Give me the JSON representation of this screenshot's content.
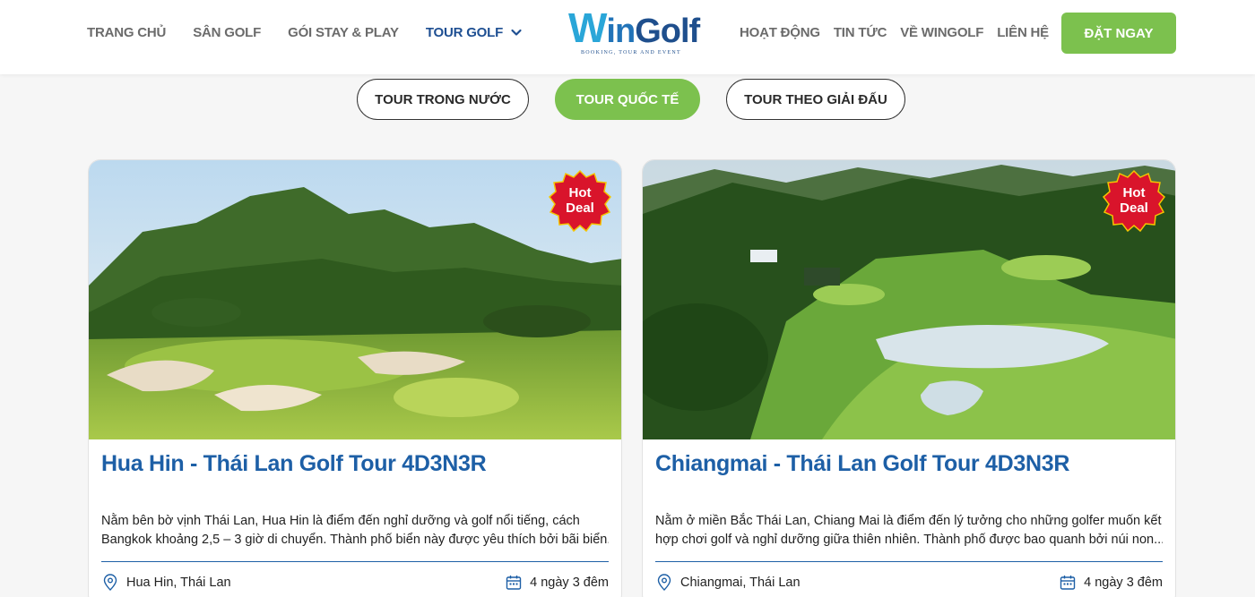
{
  "brand": {
    "logo_w": "W",
    "logo_in": "in",
    "logo_golf": "Golf",
    "tagline": "BOOKING, TOUR AND EVENT",
    "accent": "#7cc14e",
    "primary": "#1d5fa6"
  },
  "nav": {
    "left": [
      "TRANG CHỦ",
      "SÂN GOLF",
      "GÓI STAY & PLAY"
    ],
    "active": "TOUR GOLF",
    "right": [
      "HOẠT ĐỘNG",
      "TIN TỨC",
      "VỀ WINGOLF",
      "LIÊN HỆ"
    ],
    "cta": "ĐẶT NGAY"
  },
  "tabs": [
    {
      "label": "TOUR TRONG NƯỚC",
      "active": false
    },
    {
      "label": "TOUR QUỐC TẾ",
      "active": true
    },
    {
      "label": "TOUR THEO GIẢI ĐẤU",
      "active": false
    }
  ],
  "cards": [
    {
      "badge": [
        "Hot",
        "Deal"
      ],
      "title": "Hua Hin - Thái Lan Golf Tour 4D3N3R",
      "desc": [
        "Nằm bên bờ vịnh Thái Lan, Hua Hin là điểm đến nghỉ dưỡng và golf nổi tiếng, cách",
        "Bangkok khoảng 2,5 – 3 giờ di chuyển. Thành phố biển này được yêu thích bởi bãi biển..."
      ],
      "location": "Hua Hin, Thái Lan",
      "duration": "4 ngày 3 đêm"
    },
    {
      "badge": [
        "Hot",
        "Deal"
      ],
      "title": "Chiangmai - Thái Lan Golf Tour 4D3N3R",
      "desc": [
        "Nằm ở miền Bắc Thái Lan, Chiang Mai là điểm đến lý tưởng cho những golfer muốn kết",
        "hợp chơi golf và nghỉ dưỡng giữa thiên nhiên. Thành phố được bao quanh bởi núi non..."
      ],
      "location": "Chiangmai, Thái Lan",
      "duration": "4 ngày 3 đêm"
    }
  ]
}
